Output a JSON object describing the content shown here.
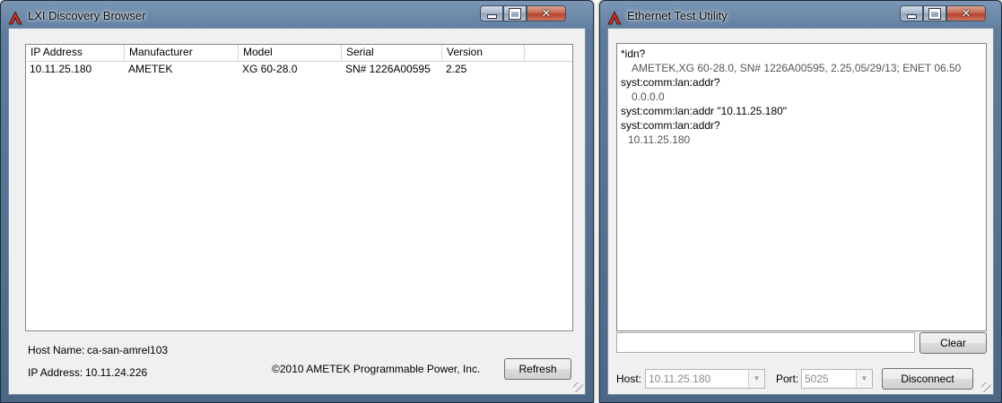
{
  "discovery": {
    "title": "LXI Discovery Browser",
    "columns": [
      "IP Address",
      "Manufacturer",
      "Model",
      "Serial",
      "Version"
    ],
    "rows": [
      [
        "10.11.25.180",
        "AMETEK",
        "XG 60-28.0",
        "SN# 1226A00595",
        "2.25"
      ]
    ],
    "host_name_label": "Host Name:",
    "host_name_value": "ca-san-amrel103",
    "ip_label": "IP Address:",
    "ip_value": "10.11.24.226",
    "copyright": "©2010 AMETEK Programmable Power, Inc.",
    "refresh_label": "Refresh"
  },
  "ethernet": {
    "title": "Ethernet Test Utility",
    "console_lines": [
      {
        "text": "*idn?",
        "kind": "cmd"
      },
      {
        "text": "AMETEK,XG 60-28.0, SN# 1226A00595, 2.25,05/29/13; ENET 06.50",
        "kind": "resp"
      },
      {
        "text": "syst:comm:lan:addr?",
        "kind": "cmd"
      },
      {
        "text": "0.0.0.0",
        "kind": "resp"
      },
      {
        "text": "syst:comm:lan:addr \"10.11.25.180\"",
        "kind": "cmd"
      },
      {
        "text": "syst:comm:lan:addr?",
        "kind": "cmd"
      },
      {
        "text": "10.11.25.180",
        "kind": "resp2"
      }
    ],
    "command_input_value": "",
    "clear_label": "Clear",
    "host_label": "Host:",
    "host_value": "10.11.25.180",
    "port_label": "Port:",
    "port_value": "5025",
    "disconnect_label": "Disconnect"
  },
  "icons": {
    "app": "ametek-logo-icon",
    "minimize": "minimize-icon",
    "maximize": "maximize-icon",
    "close": "close-icon"
  },
  "colors": {
    "accent_logo": "#d42a1c",
    "title_bar": "#6e8aa8",
    "client_bg": "#f0f0f0"
  }
}
